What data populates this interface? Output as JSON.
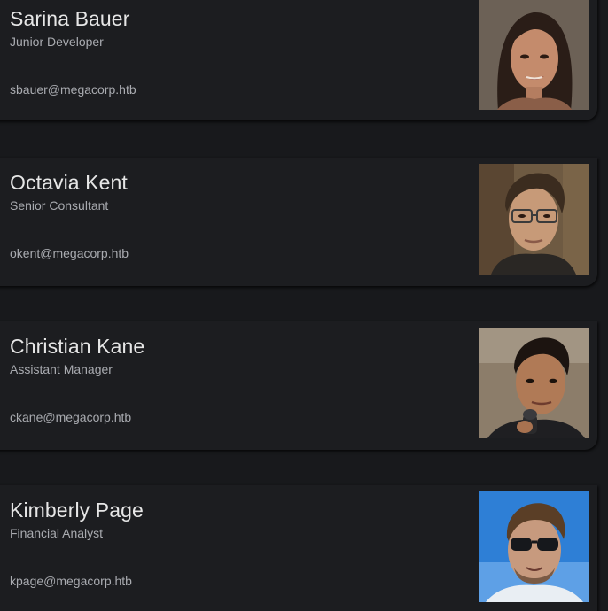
{
  "employees": [
    {
      "name": "Sarina Bauer",
      "title": "Junior Developer",
      "email": "sbauer@megacorp.htb",
      "photo_icon": "woman-portrait-photo"
    },
    {
      "name": "Octavia Kent",
      "title": "Senior Consultant",
      "email": "okent@megacorp.htb",
      "photo_icon": "man-glasses-portrait-photo"
    },
    {
      "name": "Christian Kane",
      "title": "Assistant Manager",
      "email": "ckane@megacorp.htb",
      "photo_icon": "man-microphone-portrait-photo"
    },
    {
      "name": "Kimberly Page",
      "title": "Financial Analyst",
      "email": "kpage@megacorp.htb",
      "photo_icon": "man-sunglasses-portrait-photo"
    }
  ],
  "colors": {
    "background": "#18191c",
    "card": "#1c1d20",
    "name_text": "#e6e6e6",
    "secondary_text": "#a9abb0"
  }
}
